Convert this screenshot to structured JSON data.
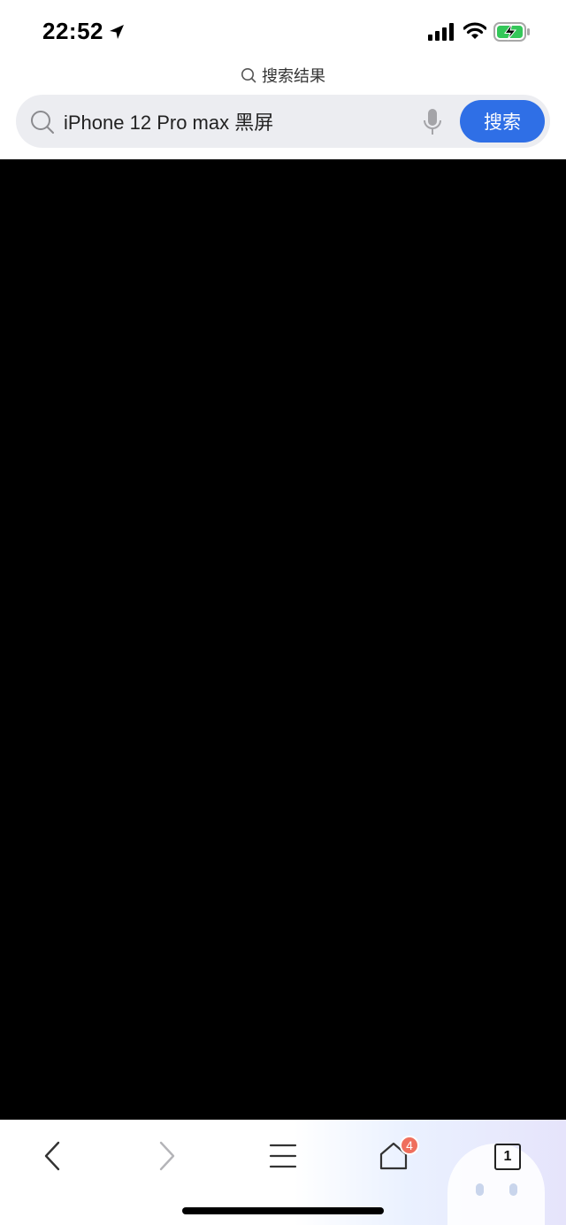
{
  "status_bar": {
    "time": "22:52",
    "icons": [
      "location-arrow-icon",
      "cellular-signal-icon",
      "wifi-icon",
      "battery-charging-icon"
    ],
    "battery_color": "#34c759"
  },
  "page_label": {
    "text": "搜索结果"
  },
  "search": {
    "query": "iPhone 12 Pro max 黑屏",
    "button_label": "搜索",
    "button_color": "#2f6fe6"
  },
  "content": {
    "background": "#000000"
  },
  "toolbar": {
    "home_badge": "4",
    "tab_count": "1",
    "icons": [
      "back-icon",
      "forward-icon",
      "menu-icon",
      "home-icon",
      "tabs-icon"
    ]
  }
}
